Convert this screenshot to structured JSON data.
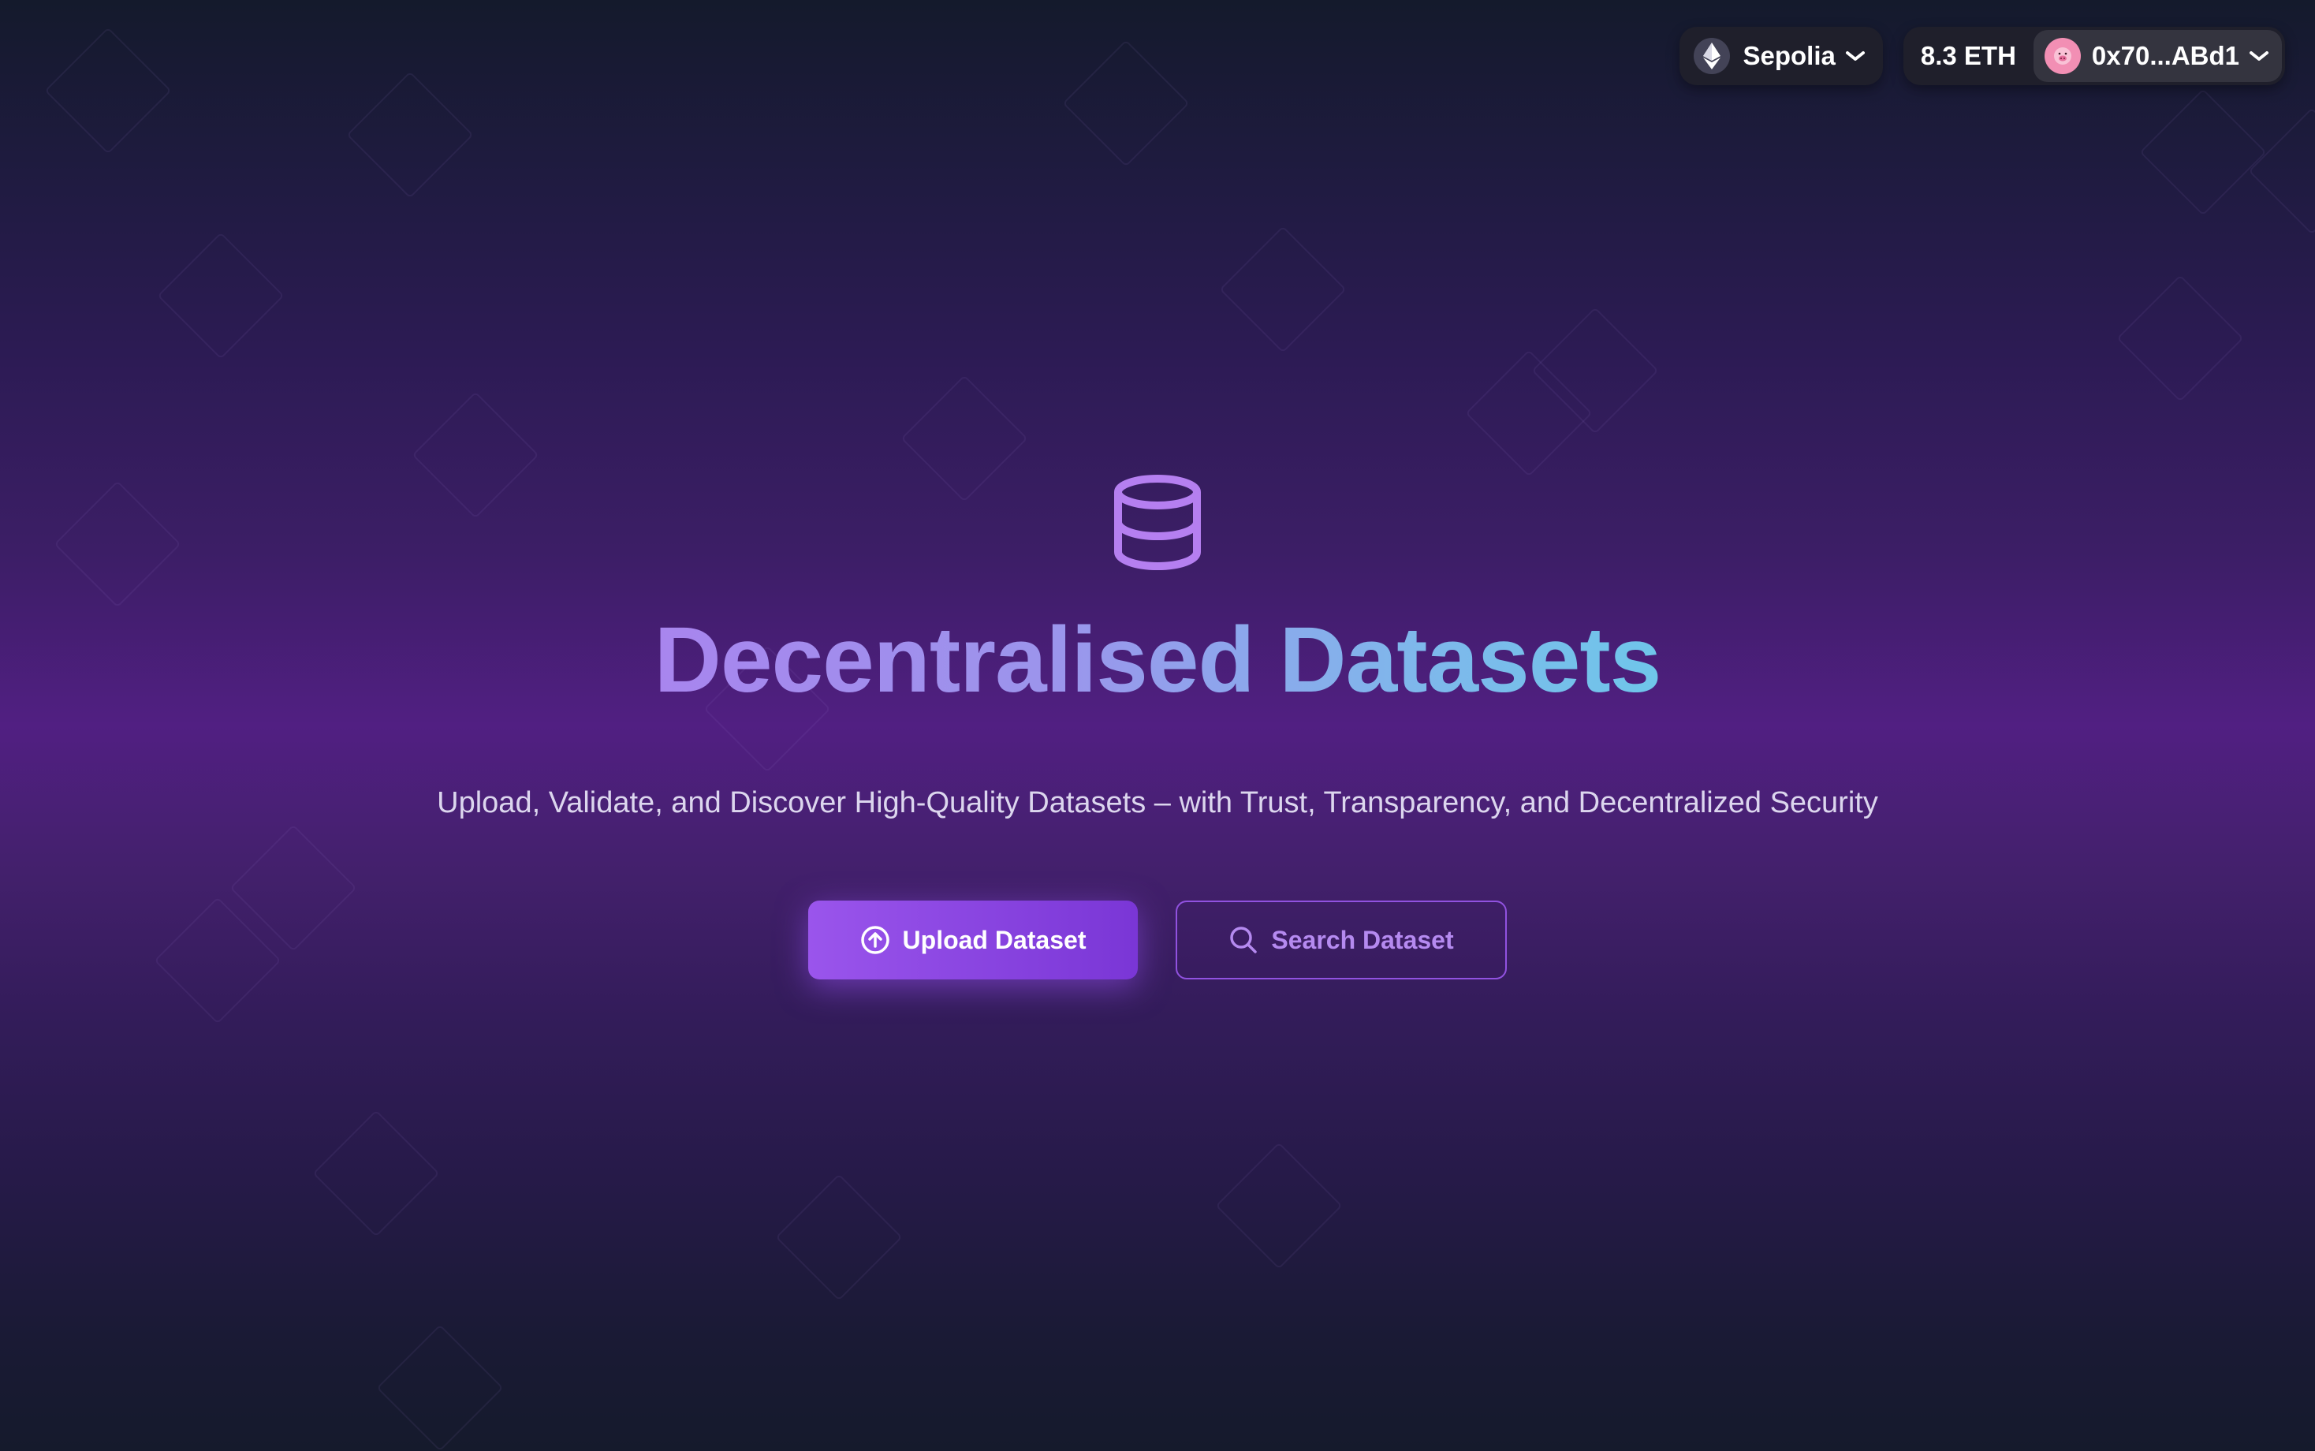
{
  "header": {
    "network": {
      "label": "Sepolia",
      "icon": "ethereum-icon"
    },
    "balance": "8.3 ETH",
    "account": {
      "address": "0x70...ABd1",
      "avatar_color": "#f28fb4",
      "avatar_icon": "pig-avatar-icon"
    }
  },
  "hero": {
    "icon": "database-icon",
    "title": "Decentralised Datasets",
    "subtitle": "Upload, Validate, and Discover High-Quality Datasets – with Trust, Transparency, and Decentralized Security",
    "actions": {
      "upload_label": "Upload Dataset",
      "upload_icon": "upload-circle-icon",
      "search_label": "Search Dataset",
      "search_icon": "search-icon"
    }
  },
  "colors": {
    "accent": "#9a55ec",
    "title_gradient_start": "#a885ee",
    "title_gradient_end": "#6fc6ea"
  }
}
